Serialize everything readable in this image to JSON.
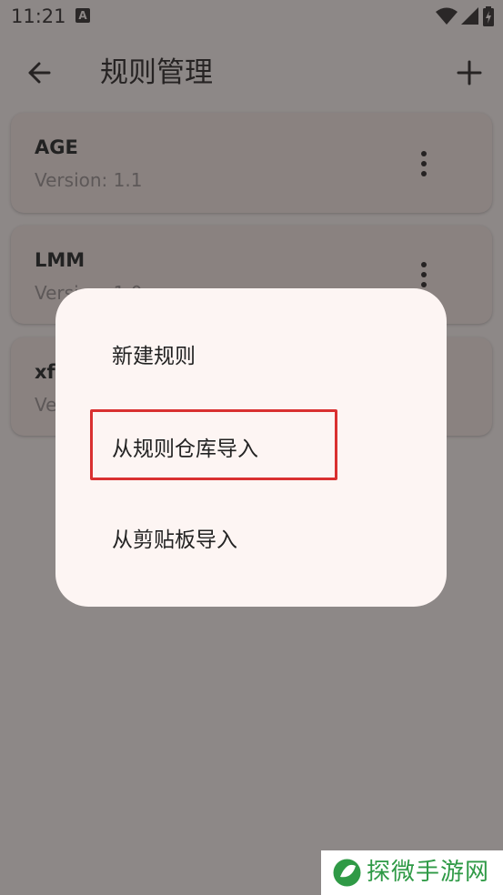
{
  "status_bar": {
    "time": "11:21",
    "notification_glyph": "A",
    "icons": [
      "wifi-icon",
      "signal-icon",
      "battery-charging-icon"
    ]
  },
  "app_bar": {
    "title": "规则管理",
    "back_icon": "arrow-left-icon",
    "add_icon": "plus-icon"
  },
  "rules": [
    {
      "name": "AGE",
      "version": "Version: 1.1"
    },
    {
      "name": "LMM",
      "version": "Version: 1.0"
    },
    {
      "name": "xf",
      "version": "Ve"
    }
  ],
  "dialog": {
    "items": [
      {
        "label": "新建规则"
      },
      {
        "label": "从规则仓库导入",
        "highlighted": true
      },
      {
        "label": "从剪贴板导入"
      }
    ],
    "highlight_color": "#d93030"
  },
  "watermark": {
    "text": "探微手游网",
    "color": "#2f9a46"
  }
}
